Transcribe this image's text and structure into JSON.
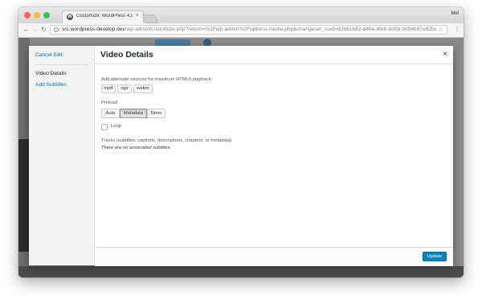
{
  "browser": {
    "tab_title": "Customize: WordPress 4.8 ‹ d",
    "tab_close": "×",
    "profile": "Mel",
    "url_host": "src.wordpress-develop.dev",
    "url_path": "/wp-admin/customize.php?return=%2Fwp-admin%2Foptions-media.php&changeset_uuid=d2b61b82-d46e-4fe6-8d0b-9094667e82bc"
  },
  "modal": {
    "cancel_label": "Cancel Edit",
    "menu": [
      "Video Details",
      "Add Subtitles"
    ],
    "title": "Video Details",
    "close": "×",
    "sources_label": "Add alternate sources for maximum HTML5 playback:",
    "sources": [
      "mp4",
      "ogv",
      "webm"
    ],
    "preload_label": "Preload",
    "preload_options": [
      "Auto",
      "Metadata",
      "None"
    ],
    "preload_selected": "Metadata",
    "loop_label": "Loop",
    "loop_checked": false,
    "tracks_label": "Tracks (subtitles, captions, descriptions, chapters, or metadata)",
    "tracks_empty": "There are no associated subtitles.",
    "update_label": "Update"
  },
  "colors": {
    "link": "#0073aa",
    "primary_button": "#0085ba"
  }
}
